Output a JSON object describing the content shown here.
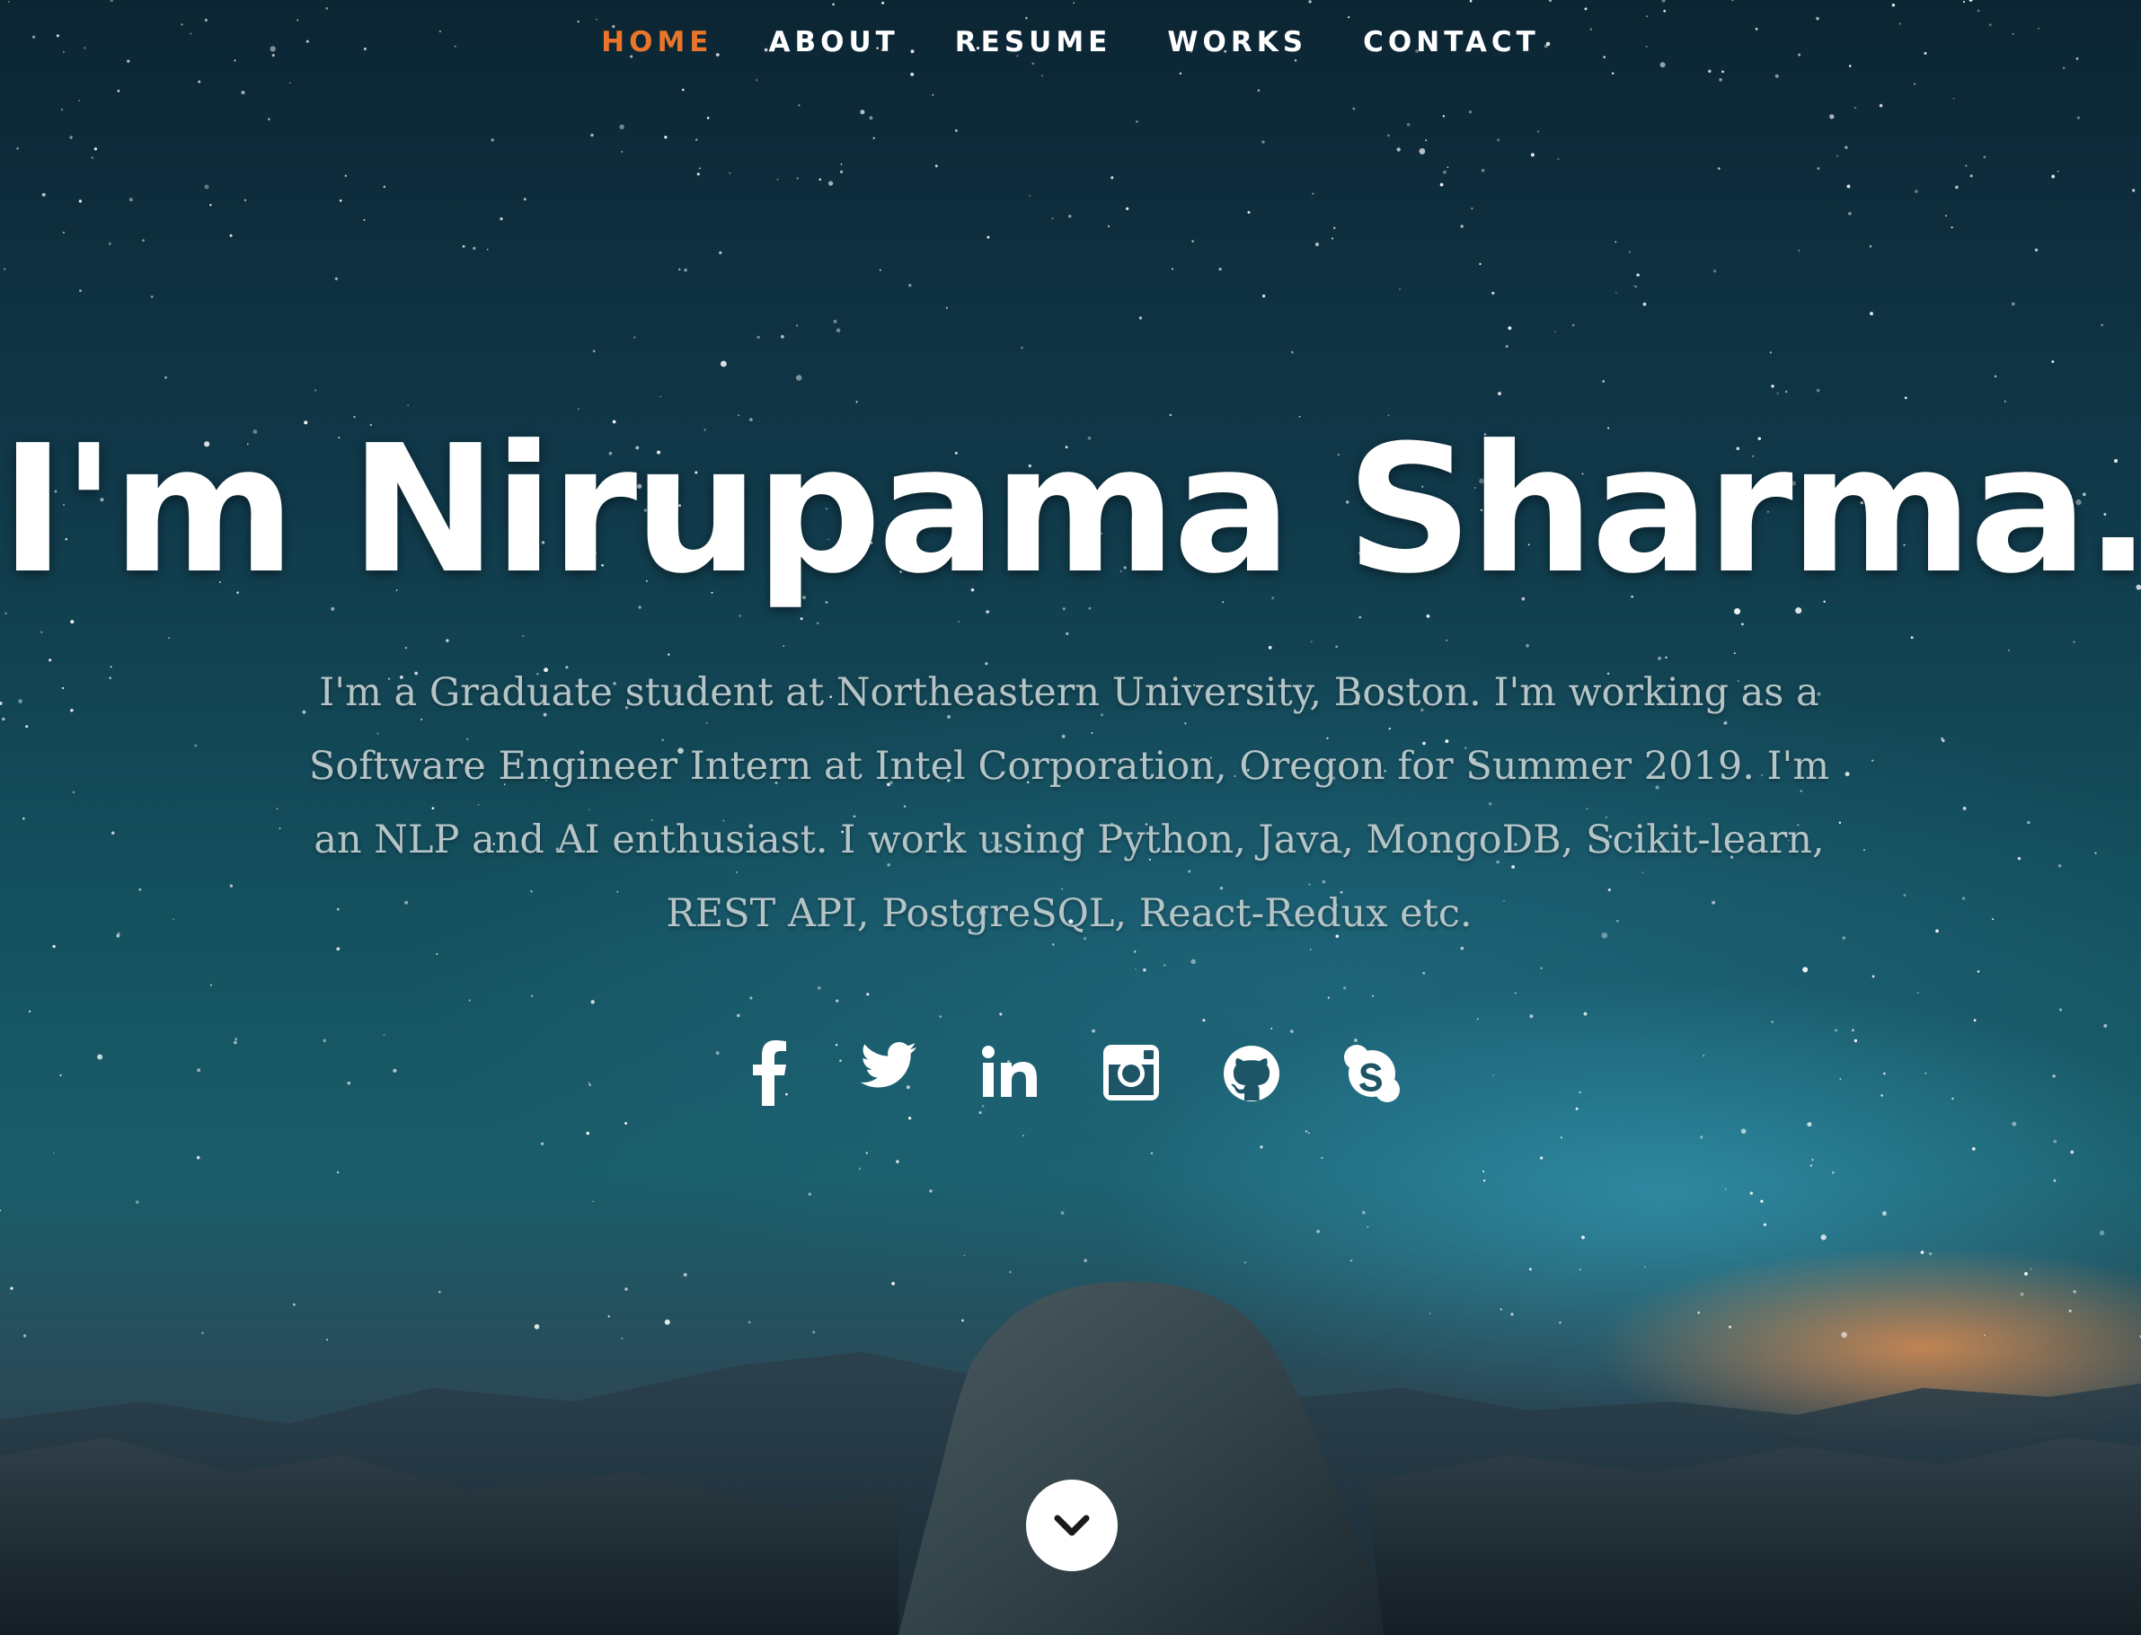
{
  "nav": {
    "items": [
      {
        "label": "HOME",
        "active": true
      },
      {
        "label": "ABOUT",
        "active": false
      },
      {
        "label": "RESUME",
        "active": false
      },
      {
        "label": "WORKS",
        "active": false
      },
      {
        "label": "CONTACT",
        "active": false
      }
    ]
  },
  "hero": {
    "headline": "I'm Nirupama Sharma.",
    "bio": "I'm a Graduate student at Northeastern University, Boston. I'm working as a Software Engineer Intern at Intel Corporation, Oregon for Summer 2019. I'm an NLP and AI enthusiast. I work using Python, Java, MongoDB, Scikit-learn, REST API, PostgreSQL, React-Redux etc."
  },
  "social": [
    "facebook-icon",
    "twitter-icon",
    "linkedin-icon",
    "instagram-icon",
    "github-icon",
    "skype-icon"
  ],
  "colors": {
    "accent": "#e8752a",
    "text": "#ffffff",
    "bio_text": "#b5c4c6"
  },
  "scroll_icon": "chevron-down-icon"
}
